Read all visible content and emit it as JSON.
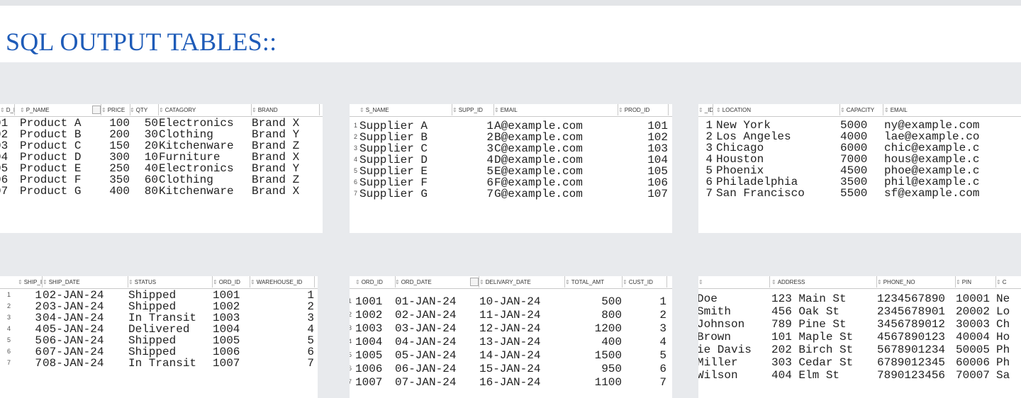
{
  "page": {
    "title": "SQL OUTPUT TABLES::"
  },
  "products": {
    "headers": [
      "D_ID",
      "P_NAME",
      "PRICE",
      "QTY",
      "CATAGORY",
      "BRAND"
    ],
    "rows": [
      [
        "01",
        "Product A",
        "100",
        "50",
        "Electronics",
        "Brand X"
      ],
      [
        "02",
        "Product B",
        "200",
        "30",
        "Clothing",
        "Brand Y"
      ],
      [
        "03",
        "Product C",
        "150",
        "20",
        "Kitchenware",
        "Brand Z"
      ],
      [
        "04",
        "Product D",
        "300",
        "10",
        "Furniture",
        "Brand X"
      ],
      [
        "05",
        "Product E",
        "250",
        "40",
        "Electronics",
        "Brand Y"
      ],
      [
        "06",
        "Product F",
        "350",
        "60",
        "Clothing",
        "Brand Z"
      ],
      [
        "07",
        "Product G",
        "400",
        "80",
        "Kitchenware",
        "Brand X"
      ]
    ]
  },
  "suppliers": {
    "headers": [
      "S_NAME",
      "SUPP_ID",
      "EMAIL",
      "PROD_ID"
    ],
    "row_numbers": [
      "1",
      "2",
      "3",
      "4",
      "5",
      "6",
      "7"
    ],
    "rows": [
      [
        "Supplier A",
        "1",
        "A@example.com",
        "101"
      ],
      [
        "Supplier B",
        "2",
        "B@example.com",
        "102"
      ],
      [
        "Supplier C",
        "3",
        "C@example.com",
        "103"
      ],
      [
        "Supplier D",
        "4",
        "D@example.com",
        "104"
      ],
      [
        "Supplier E",
        "5",
        "E@example.com",
        "105"
      ],
      [
        "Supplier F",
        "6",
        "F@example.com",
        "106"
      ],
      [
        "Supplier G",
        "7",
        "G@example.com",
        "107"
      ]
    ]
  },
  "warehouses": {
    "headers": [
      "_ID",
      "LOCATION",
      "CAPACITY",
      "EMAIL"
    ],
    "rows": [
      [
        "1",
        "New York",
        "5000",
        "ny@example.com"
      ],
      [
        "2",
        "Los Angeles",
        "4000",
        "lae@example.co"
      ],
      [
        "3",
        "Chicago",
        "6000",
        "chic@example.c"
      ],
      [
        "4",
        "Houston",
        "7000",
        "hous@example.c"
      ],
      [
        "5",
        "Phoenix",
        "4500",
        "phoe@example.c"
      ],
      [
        "6",
        "Philadelphia",
        "3500",
        "phil@example.c"
      ],
      [
        "7",
        "San Francisco",
        "5500",
        "sf@example.com"
      ]
    ]
  },
  "shipments": {
    "headers": [
      "SHIP_ID",
      "SHIP_DATE",
      "STATUS",
      "ORD_ID",
      "WAREHOUSE_ID"
    ],
    "row_numbers": [
      "1",
      "2",
      "3",
      "4",
      "5",
      "6",
      "7"
    ],
    "rows": [
      [
        "1",
        "02-JAN-24",
        "Shipped",
        "1001",
        "1"
      ],
      [
        "2",
        "03-JAN-24",
        "Shipped",
        "1002",
        "2"
      ],
      [
        "3",
        "04-JAN-24",
        "In Transit",
        "1003",
        "3"
      ],
      [
        "4",
        "05-JAN-24",
        "Delivered",
        "1004",
        "4"
      ],
      [
        "5",
        "06-JAN-24",
        "Shipped",
        "1005",
        "5"
      ],
      [
        "6",
        "07-JAN-24",
        "Shipped",
        "1006",
        "6"
      ],
      [
        "7",
        "08-JAN-24",
        "In Transit",
        "1007",
        "7"
      ]
    ]
  },
  "orders": {
    "headers": [
      "ORD_ID",
      "ORD_DATE",
      "DELIVARY_DATE",
      "TOTAL_AMT",
      "CUST_ID"
    ],
    "row_numbers": [
      "1",
      "2",
      "3",
      "4",
      "5",
      "6",
      "7"
    ],
    "rows": [
      [
        "1001",
        "01-JAN-24",
        "10-JAN-24",
        "500",
        "1"
      ],
      [
        "1002",
        "02-JAN-24",
        "11-JAN-24",
        "800",
        "2"
      ],
      [
        "1003",
        "03-JAN-24",
        "12-JAN-24",
        "1200",
        "3"
      ],
      [
        "1004",
        "04-JAN-24",
        "13-JAN-24",
        "400",
        "4"
      ],
      [
        "1005",
        "05-JAN-24",
        "14-JAN-24",
        "1500",
        "5"
      ],
      [
        "1006",
        "06-JAN-24",
        "15-JAN-24",
        "950",
        "6"
      ],
      [
        "1007",
        "07-JAN-24",
        "16-JAN-24",
        "1100",
        "7"
      ]
    ]
  },
  "customers": {
    "headers": [
      "",
      "ADDRESS",
      "PHONE_NO",
      "PIN",
      "C"
    ],
    "rows": [
      [
        "Doe",
        "123 Main St",
        "1234567890",
        "10001",
        "Ne"
      ],
      [
        "Smith",
        "456 Oak St",
        "2345678901",
        "20002",
        "Lo"
      ],
      [
        "Johnson",
        "789 Pine St",
        "3456789012",
        "30003",
        "Ch"
      ],
      [
        "Brown",
        "101 Maple St",
        "4567890123",
        "40004",
        "Ho"
      ],
      [
        "ie Davis",
        "202 Birch St",
        "5678901234",
        "50005",
        "Ph"
      ],
      [
        "Miller",
        "303 Cedar St",
        "6789012345",
        "60006",
        "Ph"
      ],
      [
        "Wilson",
        "404 Elm St",
        "7890123456",
        "70007",
        "Sa"
      ]
    ]
  }
}
